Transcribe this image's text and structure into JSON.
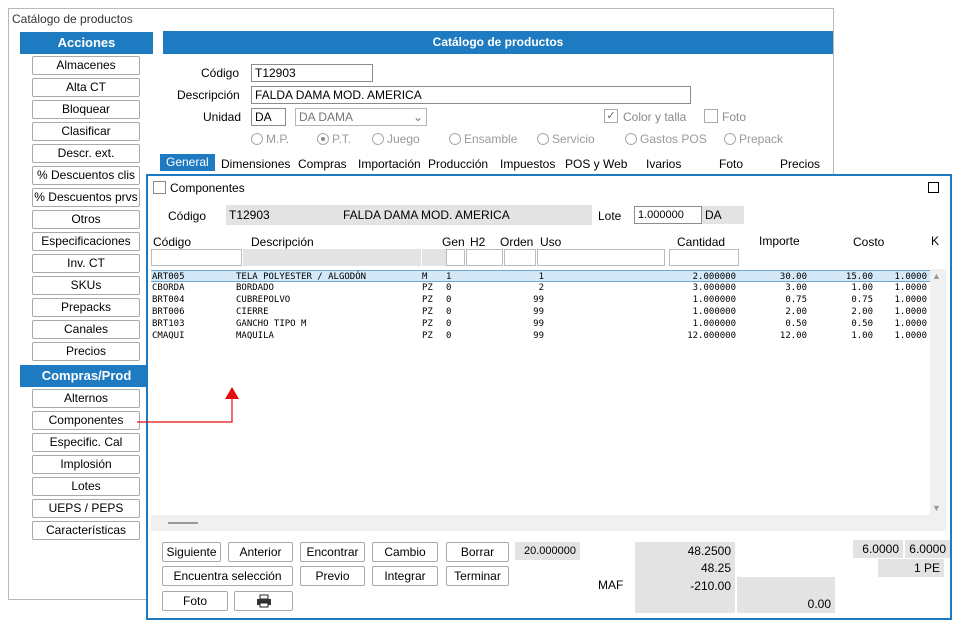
{
  "window": {
    "title": "Catálogo de productos"
  },
  "sidebar": {
    "acciones_title": "Acciones",
    "acciones": [
      "Almacenes",
      "Alta CT",
      "Bloquear",
      "Clasificar",
      "Descr. ext.",
      "% Descuentos clis",
      "% Descuentos prvs",
      "Otros",
      "Especificaciones",
      "Inv. CT",
      "SKUs",
      "Prepacks",
      "Canales",
      "Precios"
    ],
    "compras_title": "Compras/Prod",
    "compras": [
      "Alternos",
      "Componentes",
      "Especific. Cal",
      "Implosión",
      "Lotes",
      "UEPS / PEPS",
      "Características"
    ]
  },
  "main": {
    "title": "Catálogo de productos",
    "codigo_label": "Código",
    "codigo": "T12903",
    "descripcion_label": "Descripción",
    "descripcion": "FALDA DAMA MOD. AMERICA",
    "unidad_label": "Unidad",
    "unidad": "DA",
    "unidad_desc": "DA  DAMA",
    "color_talla": "Color y talla",
    "foto": "Foto",
    "radios": [
      "M.P.",
      "P.T.",
      "Juego",
      "Ensamble",
      "Servicio",
      "Gastos POS",
      "Prepack"
    ],
    "tabs": [
      "General",
      "Dimensiones",
      "Compras",
      "Importación",
      "Producción",
      "Impuestos",
      "POS y Web",
      "Ivarios",
      "Foto",
      "Precios"
    ]
  },
  "panel": {
    "title": "Componentes",
    "codigo_label": "Código",
    "codigo": "T12903",
    "descripcion": "FALDA DAMA MOD. AMERICA",
    "lote_label": "Lote",
    "lote": "1.000000",
    "lote_unit": "DA",
    "columns": [
      "Código",
      "Descripción",
      "Gen",
      "H2",
      "Orden",
      "Uso",
      "Cantidad",
      "Importe",
      "Costo",
      "K"
    ],
    "rows": [
      [
        "ART005",
        "TELA POLYESTER / ALGODÓN",
        "M",
        "1",
        "1",
        "2.000000",
        "30.00",
        "15.00",
        "1.0000"
      ],
      [
        "CBORDA",
        "BORDADO",
        "PZ",
        "0",
        "2",
        "3.000000",
        "3.00",
        "1.00",
        "1.0000"
      ],
      [
        "BRT004",
        "CUBREPOLVO",
        "PZ",
        "0",
        "99",
        "1.000000",
        "0.75",
        "0.75",
        "1.0000"
      ],
      [
        "BRT006",
        "CIERRE",
        "PZ",
        "0",
        "99",
        "1.000000",
        "2.00",
        "2.00",
        "1.0000"
      ],
      [
        "BRT103",
        "GANCHO TIPO M",
        "PZ",
        "0",
        "99",
        "1.000000",
        "0.50",
        "0.50",
        "1.0000"
      ],
      [
        "CMAQUI",
        "MAQUILA",
        "PZ",
        "0",
        "99",
        "12.000000",
        "12.00",
        "1.00",
        "1.0000"
      ]
    ],
    "buttons": {
      "siguiente": "Siguiente",
      "anterior": "Anterior",
      "encontrar": "Encontrar",
      "cambio": "Cambio",
      "borrar": "Borrar",
      "encuentra": "Encuentra selección",
      "previo": "Previo",
      "integrar": "Integrar",
      "terminar": "Terminar",
      "foto": "Foto"
    },
    "totals": {
      "box1": "20.000000",
      "importe1": "48.2500",
      "importe2": "48.25",
      "maf_label": "MAF",
      "maf": "-210.00",
      "total": "0.00",
      "r1a": "6.0000",
      "r1b": "6.0000",
      "r2": "1 PE"
    }
  }
}
